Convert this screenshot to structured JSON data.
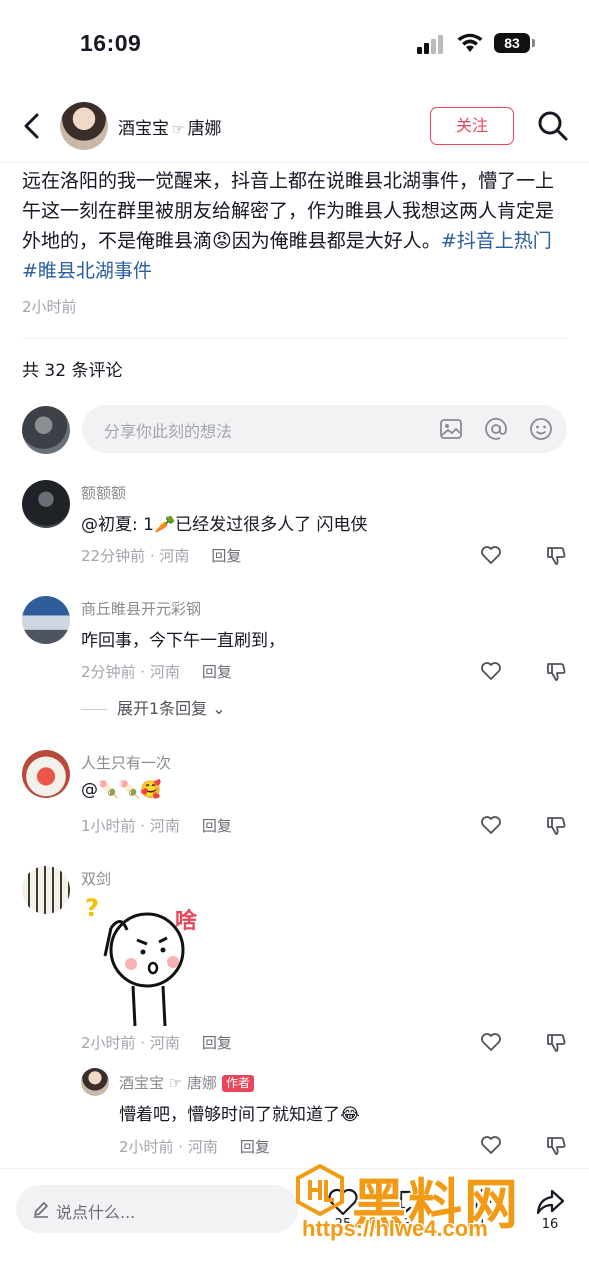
{
  "status_bar": {
    "time": "16:09",
    "battery": "83"
  },
  "header": {
    "author_name": "酒宝宝",
    "author_separator": "☞",
    "author_tag": "唐娜",
    "follow_label": "关注"
  },
  "post": {
    "text": "远在洛阳的我一觉醒来，抖音上都在说睢县北湖事件，懵了一上午这一刻在群里被朋友给解密了，作为睢县人我想这两人肯定是外地的，不是俺睢县滴😡因为俺睢县都是大好人。",
    "hashtags": [
      "#抖音上热门",
      "#睢县北湖事件"
    ],
    "time": "2小时前",
    "comment_count_label": "共 32 条评论"
  },
  "comment_input": {
    "placeholder": "分享你此刻的想法"
  },
  "comments": [
    {
      "name": "额额额",
      "text": "@初夏: 1🥕已经发过很多人了 闪电侠",
      "time": "22分钟前 · 河南",
      "reply": "回复"
    },
    {
      "name": "商丘睢县开元彩钢",
      "text": "咋回事，今下午一直刷到，",
      "time": "2分钟前 · 河南",
      "reply": "回复",
      "expand": "展开1条回复"
    },
    {
      "name": "人生只有一次",
      "text": "@🍡🍡🥰",
      "time": "1小时前 · 河南",
      "reply": "回复"
    },
    {
      "name": "双剑",
      "sticker_text": "啥",
      "time": "2小时前 · 河南",
      "reply": "回复"
    }
  ],
  "sub_reply": {
    "name": "酒宝宝",
    "separator": "☞",
    "tag": "唐娜",
    "badge": "作者",
    "text": "懵着吧，懵够时间了就知道了😂",
    "time": "2小时前 · 河南",
    "reply": "回复"
  },
  "bottom_bar": {
    "placeholder": "说点什么...",
    "likes": "25",
    "comments": "32",
    "favorites": "1",
    "shares": "16"
  },
  "watermark": {
    "logo": "黑料网",
    "url": "https://hlwe4.com"
  },
  "colors": {
    "accent": "#e8465b",
    "hashtag": "#2a5d9f",
    "watermark": "#f39a14"
  }
}
